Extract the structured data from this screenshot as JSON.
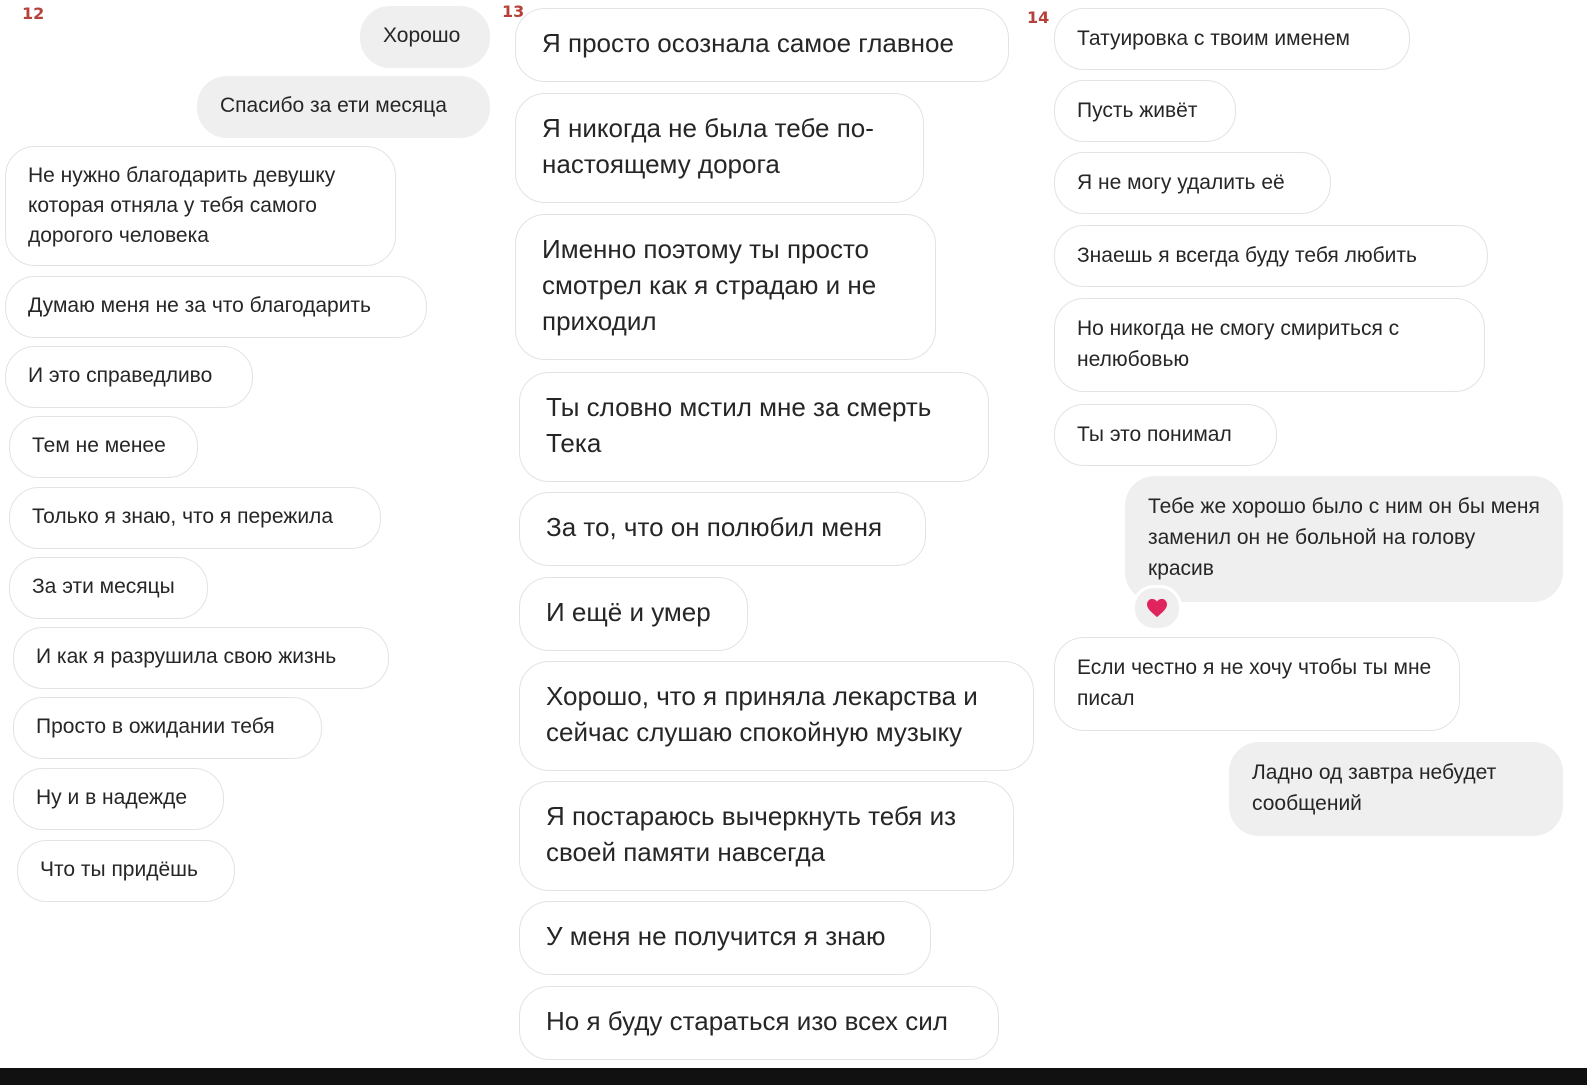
{
  "columns": [
    {
      "number": "12",
      "messages": [
        {
          "text": "Хорошо",
          "side": "sent"
        },
        {
          "text": "Спасибо за ети месяца",
          "side": "sent"
        },
        {
          "text": "Не нужно благодарить девушку которая отняла у тебя самого дорогого человека",
          "side": "received"
        },
        {
          "text": "Думаю меня не за что благодарить",
          "side": "received"
        },
        {
          "text": "И это справедливо",
          "side": "received"
        },
        {
          "text": "Тем не менее",
          "side": "received"
        },
        {
          "text": "Только я знаю, что я пережила",
          "side": "received"
        },
        {
          "text": "За эти месяцы",
          "side": "received"
        },
        {
          "text": "И как я разрушила свою жизнь",
          "side": "received"
        },
        {
          "text": "Просто в ожидании тебя",
          "side": "received"
        },
        {
          "text": "Ну и в надежде",
          "side": "received"
        },
        {
          "text": "Что ты придёшь",
          "side": "received"
        }
      ]
    },
    {
      "number": "13",
      "messages": [
        {
          "text": "Я просто осознала самое главное",
          "side": "received"
        },
        {
          "text": "Я никогда не была тебе по-настоящему дорога",
          "side": "received"
        },
        {
          "text": "Именно поэтому ты просто смотрел как я страдаю и не приходил",
          "side": "received"
        },
        {
          "text": "Ты словно мстил мне за смерть Тека",
          "side": "received"
        },
        {
          "text": "За то, что он полюбил меня",
          "side": "received"
        },
        {
          "text": "И ещё и умер",
          "side": "received"
        },
        {
          "text": "Хорошо, что я приняла лекарства и сейчас слушаю спокойную музыку",
          "side": "received"
        },
        {
          "text": "Я постараюсь вычеркнуть тебя из своей памяти навсегда",
          "side": "received"
        },
        {
          "text": "У меня не получится я знаю",
          "side": "received"
        },
        {
          "text": "Но я буду стараться изо всех сил",
          "side": "received"
        }
      ]
    },
    {
      "number": "14",
      "messages": [
        {
          "text": "Татуировка с твоим именем",
          "side": "received"
        },
        {
          "text": "Пусть живёт",
          "side": "received"
        },
        {
          "text": "Я не могу удалить её",
          "side": "received"
        },
        {
          "text": "Знаешь я всегда буду тебя любить",
          "side": "received"
        },
        {
          "text": "Но никогда не смогу смириться с нелюбовью",
          "side": "received"
        },
        {
          "text": "Ты это понимал",
          "side": "received"
        },
        {
          "text": "Тебе же хорошо было с ним он бы меня заменил он не больной на голову красив",
          "side": "sent",
          "reaction": "heart-icon"
        },
        {
          "text": "Если честно я не хочу чтобы ты мне писал",
          "side": "received"
        },
        {
          "text": "Ладно од завтра небудет сообщений",
          "side": "sent"
        }
      ]
    }
  ],
  "colors": {
    "sent_bubble": "#efefef",
    "received_border": "#e3e3e3",
    "column_number": "#b5413a",
    "heart": "#e0245e"
  }
}
